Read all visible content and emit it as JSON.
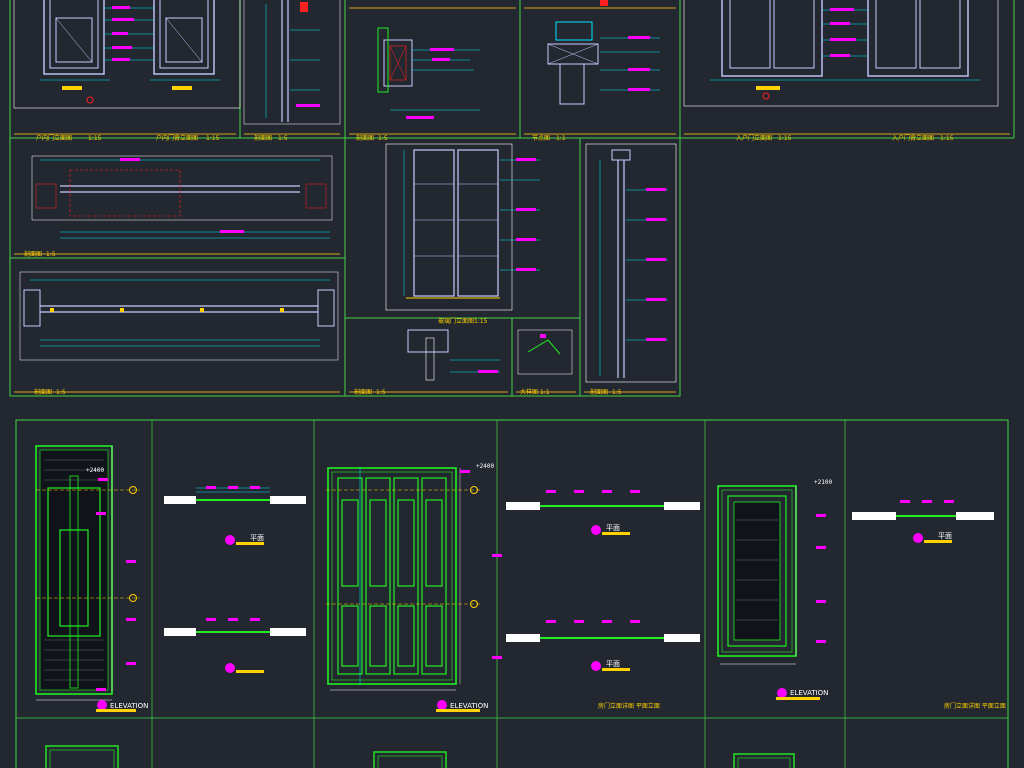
{
  "colors": {
    "background": "#232830",
    "frame_upper": "#44d044",
    "frame_lower": "#3fd33f",
    "title_bar": "#d4a21a",
    "door_line": "#c8c8ff",
    "door_fill": "#2a2f45",
    "cyan": "#00e5ff",
    "magenta": "#ff00ff",
    "yellow": "#ffd200",
    "red": "#ff2020",
    "green": "#22ee22",
    "white": "#ffffff"
  },
  "upper_sheet": {
    "titles": {
      "door_elev_left": "户内门立面图",
      "door_elev_left_scale": "1:15",
      "door_elev_right": "户内门背立面图",
      "door_elev_right_scale": "1:15",
      "side_section": "剖面图",
      "side_section_scale": "1:5",
      "section_a": "剖面图",
      "section_a_scale": "1:5",
      "section_b": "节点图",
      "section_b_scale": "1:1",
      "entry_front": "入户门立面图",
      "entry_front_scale": "1:15",
      "entry_back": "入户门背立面图",
      "entry_back_scale": "1:15",
      "plan_top": "剖面图",
      "plan_top_scale": "1:5",
      "plan_bottom": "剖面图",
      "plan_bottom_scale": "1:5",
      "cabinet_elev": "玻璃门立面图",
      "cabinet_elev_scale": "1:15",
      "detail_c": "剖面图",
      "detail_c_scale": "1:5",
      "detail_d": "大样图",
      "detail_d_scale": "1:1",
      "long_section": "剖面图",
      "long_section_scale": "1:5"
    }
  },
  "lower_sheet": {
    "door1": {
      "level": "+2400",
      "elevation": "ELEVATION",
      "plan": "平面",
      "caption": ""
    },
    "door2": {
      "level": "+2400",
      "elevation": "ELEVATION",
      "plan_a": "平面",
      "plan_b": "平面",
      "caption": "房门立面详图 平面立面"
    },
    "door3": {
      "level": "+2100",
      "elevation": "ELEVATION",
      "plan": "平面",
      "caption": "房门立面详图 平面立面"
    }
  }
}
